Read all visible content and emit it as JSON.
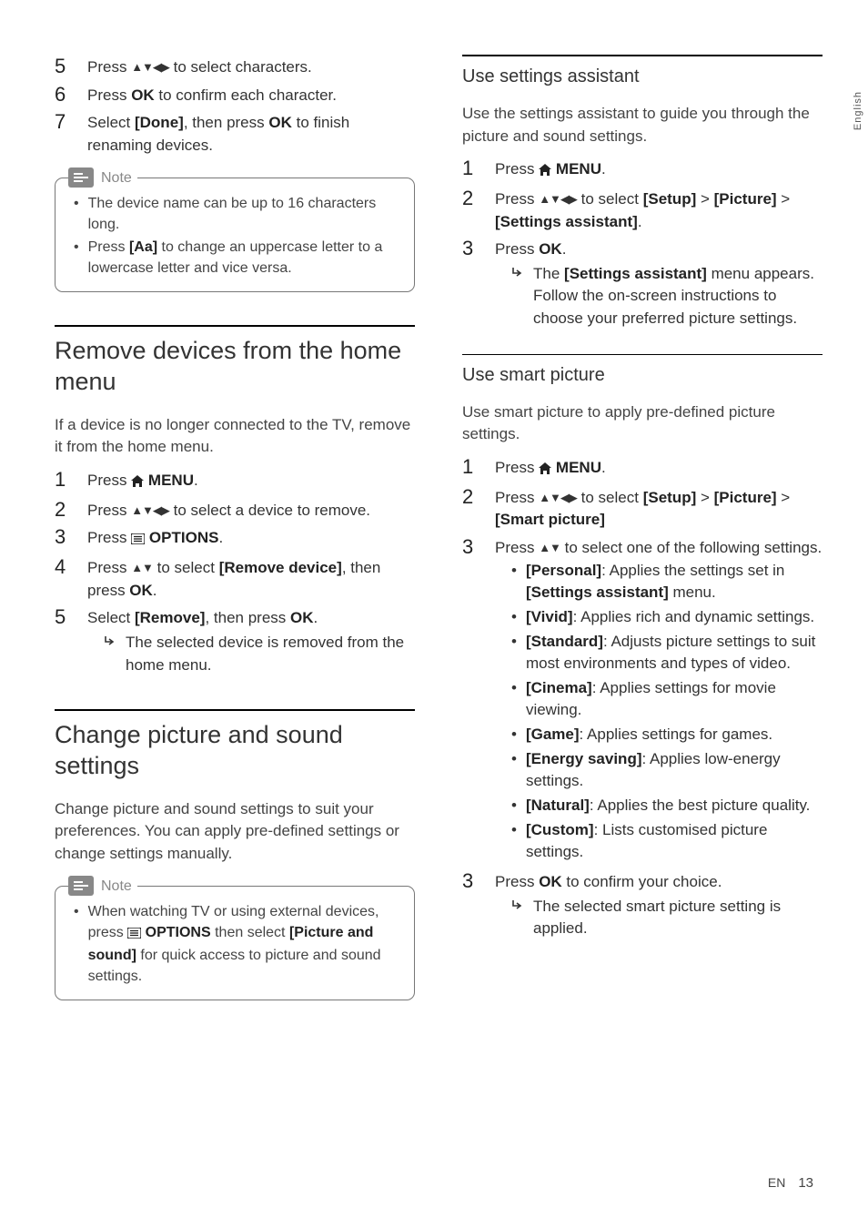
{
  "sideTab": "English",
  "footer": {
    "lang": "EN",
    "page": "13"
  },
  "icons": {
    "up": "▲",
    "down": "▼",
    "left": "◀",
    "right": "▶",
    "udlr": "▲▼◀▶",
    "ud": "▲▼"
  },
  "left": {
    "topSteps": {
      "s5": {
        "num": "5",
        "pre": "Press ",
        "post": " to select characters."
      },
      "s6": {
        "num": "6",
        "pre": "Press ",
        "ok": "OK",
        "post": " to confirm each character."
      },
      "s7": {
        "num": "7",
        "pre": "Select ",
        "done": "[Done]",
        "mid": ", then press ",
        "ok": "OK",
        "post": " to finish renaming devices."
      }
    },
    "note1": {
      "label": "Note",
      "li1": "The device name can be up to 16 characters long.",
      "li2a": "Press ",
      "li2b": "[Aa]",
      "li2c": " to change an uppercase letter to a lowercase letter and vice versa."
    },
    "removeTitle": "Remove devices from the home menu",
    "removeIntro": "If a device is no longer connected to the TV, remove it from the home menu.",
    "removeSteps": {
      "s1": {
        "num": "1",
        "pre": "Press ",
        "menu": "MENU",
        "post": "."
      },
      "s2": {
        "num": "2",
        "pre": "Press ",
        "post": " to select a device to remove."
      },
      "s3": {
        "num": "3",
        "pre": "Press ",
        "opts": "OPTIONS",
        "post": "."
      },
      "s4": {
        "num": "4",
        "pre": "Press ",
        "mid": " to select ",
        "rd": "[Remove device]",
        "mid2": ", then press ",
        "ok": "OK",
        "post": "."
      },
      "s5": {
        "num": "5",
        "pre": "Select ",
        "rm": "[Remove]",
        "mid": ", then press ",
        "ok": "OK",
        "post": ".",
        "sub": "The selected device is removed from the home menu."
      }
    },
    "changeTitle": "Change picture and sound settings",
    "changeIntro": "Change picture and sound settings to suit your preferences. You can apply pre-defined settings or change settings manually.",
    "note2": {
      "label": "Note",
      "li1a": "When watching TV or using external devices, press ",
      "li1b": "OPTIONS",
      "li1c": " then select ",
      "li1d": "[Picture and sound]",
      "li1e": " for quick access to picture and sound settings."
    }
  },
  "right": {
    "assistTitle": "Use settings assistant",
    "assistIntro": "Use the settings assistant to guide you through the picture and sound settings.",
    "assistSteps": {
      "s1": {
        "num": "1",
        "pre": "Press ",
        "menu": "MENU",
        "post": "."
      },
      "s2": {
        "num": "2",
        "pre": "Press ",
        "mid": " to select ",
        "a": "[Setup]",
        "gt": " > ",
        "b": "[Picture]",
        "gt2": " > ",
        "c": "[Settings assistant]",
        "post": "."
      },
      "s3": {
        "num": "3",
        "pre": "Press ",
        "ok": "OK",
        "post": ".",
        "subPre": "The ",
        "subBold": "[Settings assistant]",
        "subPost": " menu appears. Follow the on-screen instructions to choose your preferred picture settings."
      }
    },
    "smartTitle": "Use smart picture",
    "smartIntro": "Use smart picture to apply pre-defined picture settings.",
    "smartSteps": {
      "s1": {
        "num": "1",
        "pre": "Press ",
        "menu": "MENU",
        "post": "."
      },
      "s2": {
        "num": "2",
        "pre": "Press ",
        "mid": " to select ",
        "a": "[Setup]",
        "gt": " > ",
        "b": "[Picture]",
        "gt2": " > ",
        "c": "[Smart picture]"
      },
      "s3": {
        "num": "3",
        "pre": "Press ",
        "post": " to select one of the following settings."
      },
      "bullets": {
        "b1a": "[Personal]",
        "b1b": ": Applies the settings set in ",
        "b1c": "[Settings assistant]",
        "b1d": " menu.",
        "b2a": "[Vivid]",
        "b2b": ": Applies rich and dynamic settings.",
        "b3a": "[Standard]",
        "b3b": ": Adjusts picture settings to suit most environments and types of video.",
        "b4a": "[Cinema]",
        "b4b": ": Applies settings for movie viewing.",
        "b5a": "[Game]",
        "b5b": ": Applies settings for games.",
        "b6a": "[Energy saving]",
        "b6b": ": Applies low-energy settings.",
        "b7a": "[Natural]",
        "b7b": ": Applies the best picture quality.",
        "b8a": "[Custom]",
        "b8b": ": Lists customised picture settings."
      },
      "s3b": {
        "num": "3",
        "pre": "Press ",
        "ok": "OK",
        "post": " to confirm your choice.",
        "sub": "The selected smart picture setting is applied."
      }
    }
  }
}
